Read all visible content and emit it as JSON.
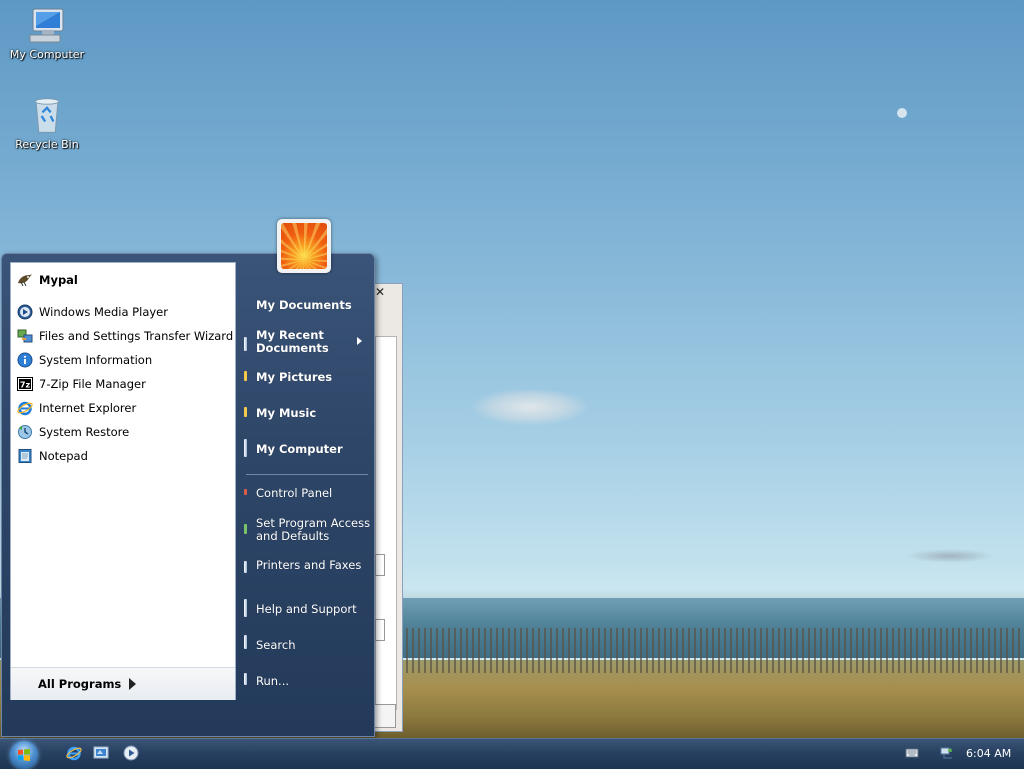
{
  "desktop": {
    "icons": [
      {
        "label": "My Computer"
      },
      {
        "label": "Recycle Bin"
      }
    ]
  },
  "start_menu": {
    "pinned": [
      {
        "label": "Mypal",
        "icon": "mypal-icon"
      }
    ],
    "recent": [
      {
        "label": "Windows Media Player",
        "icon": "media-player-icon"
      },
      {
        "label": "Files and Settings Transfer Wizard",
        "icon": "transfer-wizard-icon"
      },
      {
        "label": "System Information",
        "icon": "info-icon"
      },
      {
        "label": "7-Zip File Manager",
        "icon": "7zip-icon"
      },
      {
        "label": "Internet Explorer",
        "icon": "ie-icon"
      },
      {
        "label": "System Restore",
        "icon": "restore-icon"
      },
      {
        "label": "Notepad",
        "icon": "notepad-icon"
      }
    ],
    "all_programs": "All Programs",
    "right": {
      "my_documents": "My Documents",
      "my_recent_documents_1": "My Recent",
      "my_recent_documents_2": "Documents",
      "my_pictures": "My Pictures",
      "my_music": "My Music",
      "my_computer": "My Computer",
      "control_panel": "Control Panel",
      "set_program_access_1": "Set Program Access",
      "set_program_access_2": "and Defaults",
      "printers_faxes": "Printers and Faxes",
      "help_support": "Help and Support",
      "search": "Search",
      "run": "Run..."
    }
  },
  "taskbar": {
    "clock": "6:04 AM"
  },
  "colors": {
    "menu_blue": "#2e4668",
    "taskbar_blue": "#284161"
  }
}
